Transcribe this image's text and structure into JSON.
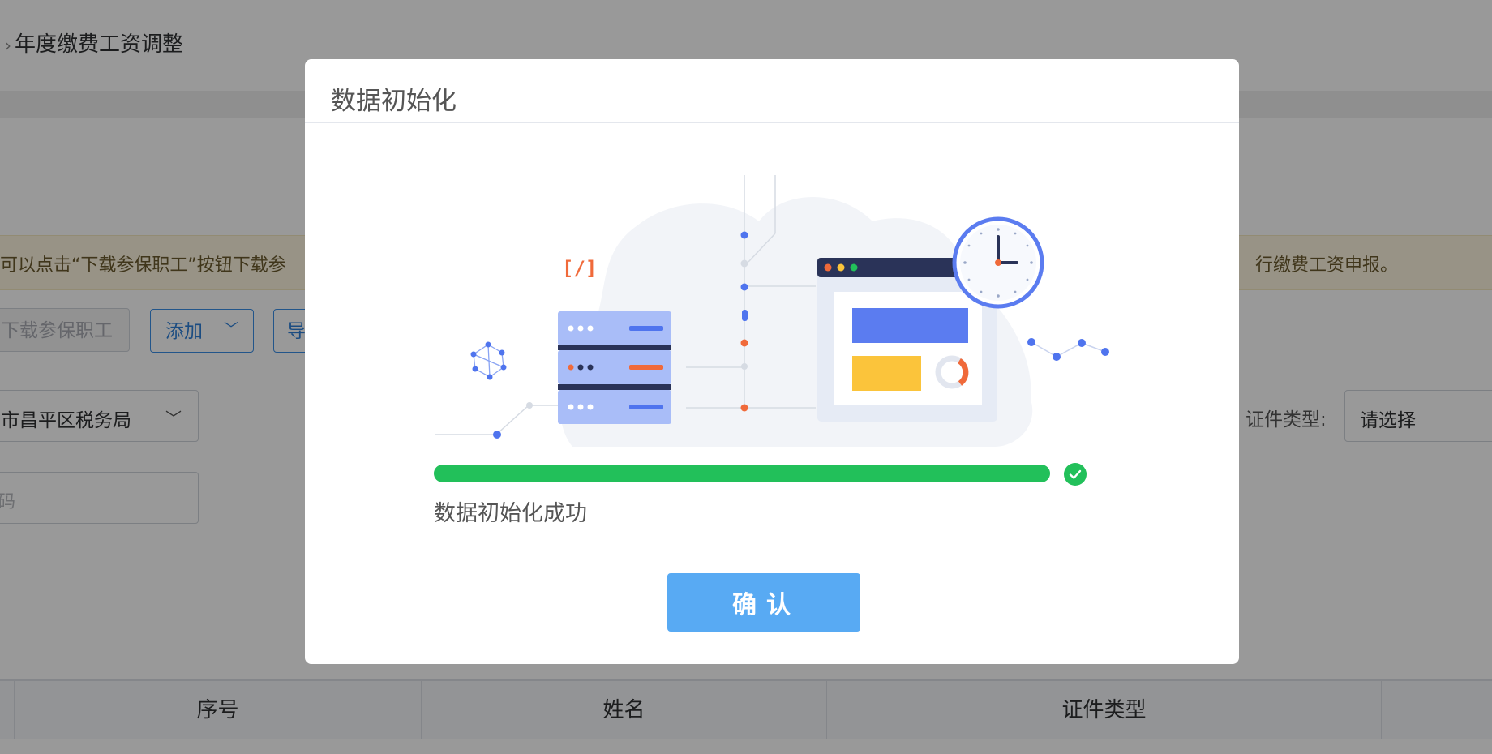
{
  "breadcrumb": {
    "current": "年度缴费工资调整"
  },
  "notice": {
    "left_text": "可以点击“下载参保职工”按钮下载参",
    "right_text": "行缴费工资申报。"
  },
  "toolbar": {
    "download_label": "下载参保职工",
    "add_label": "添加",
    "import_label": "导"
  },
  "filters": {
    "tax_bureau_value": "市昌平区税务局",
    "code_placeholder": "码",
    "id_type_label": "证件类型:",
    "id_type_value": "请选择"
  },
  "table": {
    "columns": [
      "序号",
      "姓名",
      "证件类型"
    ]
  },
  "modal": {
    "title": "数据初始化",
    "progress": 1.0,
    "status_text": "数据初始化成功",
    "confirm_label": "确认",
    "code_glyph": "[/]"
  },
  "colors": {
    "progress": "#22c05a",
    "confirm": "#58aaf3",
    "primary_border": "#3a8ee6"
  },
  "icons": {
    "progress_done": "check-circle-icon",
    "dropdown": "chevron-down-icon"
  }
}
